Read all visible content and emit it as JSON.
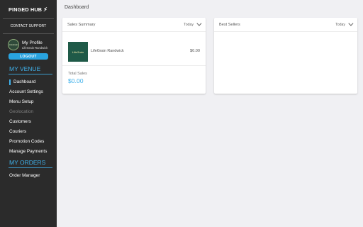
{
  "brand": {
    "name": "PINGED HUB",
    "icon": "bolt-icon"
  },
  "sidebar": {
    "contact_support": "CONTACT SUPPORT",
    "profile": {
      "name": "My Profile",
      "venue": "LifeGrain Randwick",
      "avatar_text": "LifeGrain"
    },
    "logout_label": "LOGOUT",
    "venue_section": {
      "title": "MY VENUE",
      "items": [
        {
          "label": "Dashboard"
        },
        {
          "label": "Account Settings"
        },
        {
          "label": "Menu Setup"
        },
        {
          "label": "Geolocation"
        },
        {
          "label": "Customers"
        },
        {
          "label": "Couriers"
        },
        {
          "label": "Promotion Codes"
        },
        {
          "label": "Manage Payments"
        }
      ]
    },
    "orders_section": {
      "title": "MY ORDERS",
      "items": [
        {
          "label": "Order Manager"
        }
      ]
    }
  },
  "header": {
    "title": "Dashboard"
  },
  "sales_summary": {
    "title": "Sales Summary",
    "range": "Today",
    "venue": {
      "name": "LifeGrain Randwick",
      "amount": "$0.00",
      "logo_text": "LifeGrain"
    },
    "total_label": "Total Sales",
    "total_value": "$0.00"
  },
  "best_sellers": {
    "title": "Best Sellers",
    "range": "Today"
  },
  "colors": {
    "accent": "#3fb0ea",
    "sidebar_bg": "#2b2b2b",
    "page_bg": "#f0f0f3"
  }
}
